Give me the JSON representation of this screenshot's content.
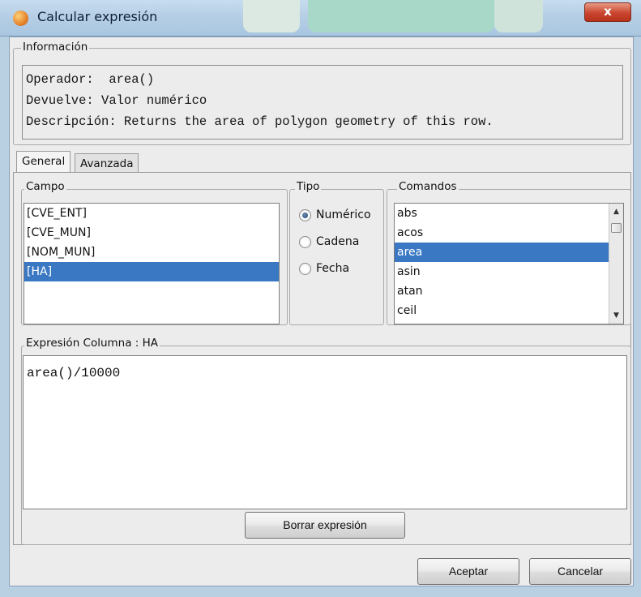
{
  "window": {
    "title": "Calcular expresión",
    "close_glyph": "x"
  },
  "info": {
    "group_label": "Información",
    "operator_line": "Operador:  area()",
    "returns_line": "Devuelve: Valor numérico",
    "description_line": "Descripción: Returns the area of polygon geometry of this row."
  },
  "tabs": [
    {
      "label": "General",
      "active": true
    },
    {
      "label": "Avanzada",
      "active": false
    }
  ],
  "campo": {
    "label": "Campo",
    "items": [
      {
        "label": "[CVE_ENT]",
        "selected": false
      },
      {
        "label": "[CVE_MUN]",
        "selected": false
      },
      {
        "label": "[NOM_MUN]",
        "selected": false
      },
      {
        "label": "[HA]",
        "selected": true
      }
    ]
  },
  "tipo": {
    "label": "Tipo",
    "options": [
      {
        "label": "Numérico",
        "checked": true
      },
      {
        "label": "Cadena",
        "checked": false
      },
      {
        "label": "Fecha",
        "checked": false
      }
    ]
  },
  "comandos": {
    "label": "Comandos",
    "items": [
      {
        "label": "abs",
        "selected": false
      },
      {
        "label": "acos",
        "selected": false
      },
      {
        "label": "area",
        "selected": true
      },
      {
        "label": "asin",
        "selected": false
      },
      {
        "label": "atan",
        "selected": false
      },
      {
        "label": "ceil",
        "selected": false
      }
    ]
  },
  "expression": {
    "label": "Expresión Columna : HA",
    "value": "area()/10000",
    "clear_button": "Borrar expresión"
  },
  "footer": {
    "accept_button": "Aceptar",
    "cancel_button": "Cancelar"
  },
  "colors": {
    "selection": "#3b78c4",
    "titlebar": "#b6cfe6",
    "close": "#c9452e"
  }
}
